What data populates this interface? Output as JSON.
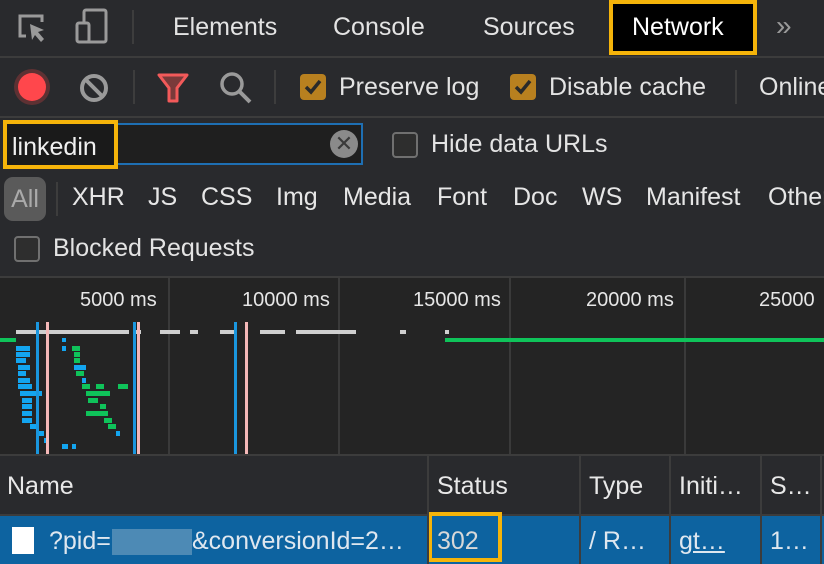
{
  "tabbar": {
    "tabs": [
      {
        "label": "Elements",
        "active": false
      },
      {
        "label": "Console",
        "active": false
      },
      {
        "label": "Sources",
        "active": false
      },
      {
        "label": "Network",
        "active": true
      }
    ],
    "more_label": "»",
    "icons": [
      "inspect-element-icon",
      "device-toolbar-icon"
    ]
  },
  "toolbar": {
    "record": {
      "icon": "record-icon",
      "color": "#ff4747",
      "recording": true
    },
    "clear": {
      "icon": "clear-icon"
    },
    "filter": {
      "icon": "filter-icon",
      "color": "#f25a5a"
    },
    "search": {
      "icon": "search-icon"
    },
    "preserve_log": {
      "label": "Preserve log",
      "checked": true
    },
    "disable_cache": {
      "label": "Disable cache",
      "checked": true
    },
    "throttling": {
      "label": "Online"
    }
  },
  "filter_row": {
    "filter_value": "linkedin",
    "hide_data_urls": {
      "label": "Hide data URLs",
      "checked": false
    }
  },
  "resource_types": [
    "All",
    "XHR",
    "JS",
    "CSS",
    "Img",
    "Media",
    "Font",
    "Doc",
    "WS",
    "Manifest",
    "Other"
  ],
  "active_type": "All",
  "blocked_requests": {
    "label": "Blocked Requests",
    "checked": false
  },
  "overview": {
    "ticks": [
      "5000 ms",
      "10000 ms",
      "15000 ms",
      "20000 ms",
      "25000"
    ],
    "colors": {
      "dom_content_loaded": "#1a96de",
      "load": "#f4b8b8",
      "waiting": "#0fc35a",
      "download": "#13a5f0",
      "queue": "#cfcfcf"
    }
  },
  "table": {
    "columns": [
      "Name",
      "Status",
      "Type",
      "Initi…",
      "S…"
    ],
    "rows": [
      {
        "name_prefix": "?pid=",
        "name_suffix": "&conversionId=2…",
        "status": "302",
        "type": "/ R…",
        "initiator": "gt…",
        "size": "1…",
        "selected": true
      }
    ]
  },
  "highlight_color": "#f5b40a",
  "selection_color": "#0d63a0"
}
